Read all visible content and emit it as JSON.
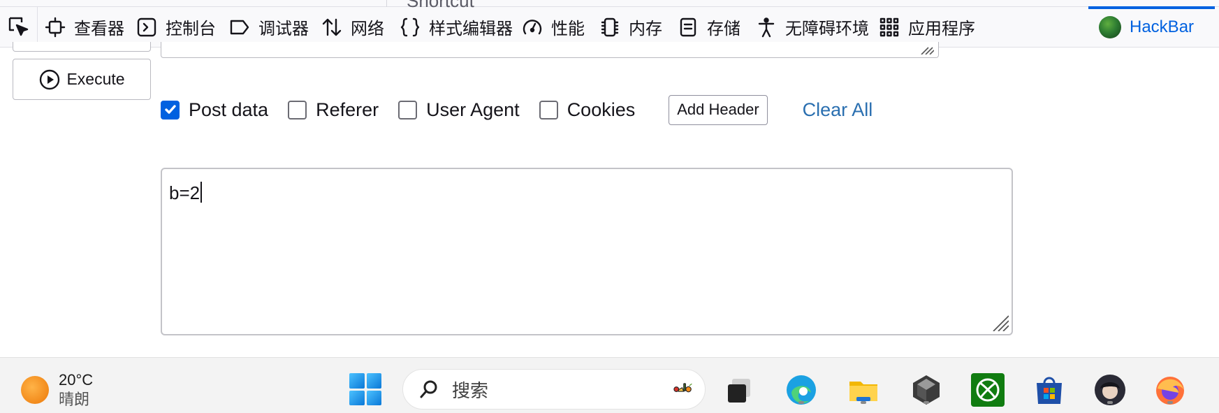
{
  "devtools": {
    "tabs": [
      {
        "label": "查看器",
        "icon": "inspector-icon"
      },
      {
        "label": "控制台",
        "icon": "console-icon"
      },
      {
        "label": "调试器",
        "icon": "debugger-icon"
      },
      {
        "label": "网络",
        "icon": "network-icon"
      },
      {
        "label": "样式编辑器",
        "icon": "style-editor-icon"
      },
      {
        "label": "性能",
        "icon": "performance-icon"
      },
      {
        "label": "内存",
        "icon": "memory-icon"
      },
      {
        "label": "存储",
        "icon": "storage-icon"
      },
      {
        "label": "无障碍环境",
        "icon": "accessibility-icon"
      },
      {
        "label": "应用程序",
        "icon": "application-icon"
      },
      {
        "label": "HackBar",
        "icon": "hackbar-logo-icon",
        "active": true
      }
    ],
    "accent_color": "#0061e0"
  },
  "hackbar": {
    "clipped_text": "Shortcut",
    "execute_label": "Execute",
    "options": [
      {
        "label": "Post data",
        "checked": true
      },
      {
        "label": "Referer",
        "checked": false
      },
      {
        "label": "User Agent",
        "checked": false
      },
      {
        "label": "Cookies",
        "checked": false
      }
    ],
    "add_header_label": "Add Header",
    "clear_all_label": "Clear All",
    "post_body": "b=2"
  },
  "taskbar": {
    "weather": {
      "temp": "20°C",
      "condition": "晴朗"
    },
    "search_placeholder": "搜索",
    "apps": [
      "start-icon",
      "task-view-icon",
      "edge-icon",
      "file-explorer-icon",
      "unity-icon",
      "xbox-icon",
      "microsoft-store-icon",
      "avatar-app-icon",
      "firefox-icon"
    ]
  }
}
